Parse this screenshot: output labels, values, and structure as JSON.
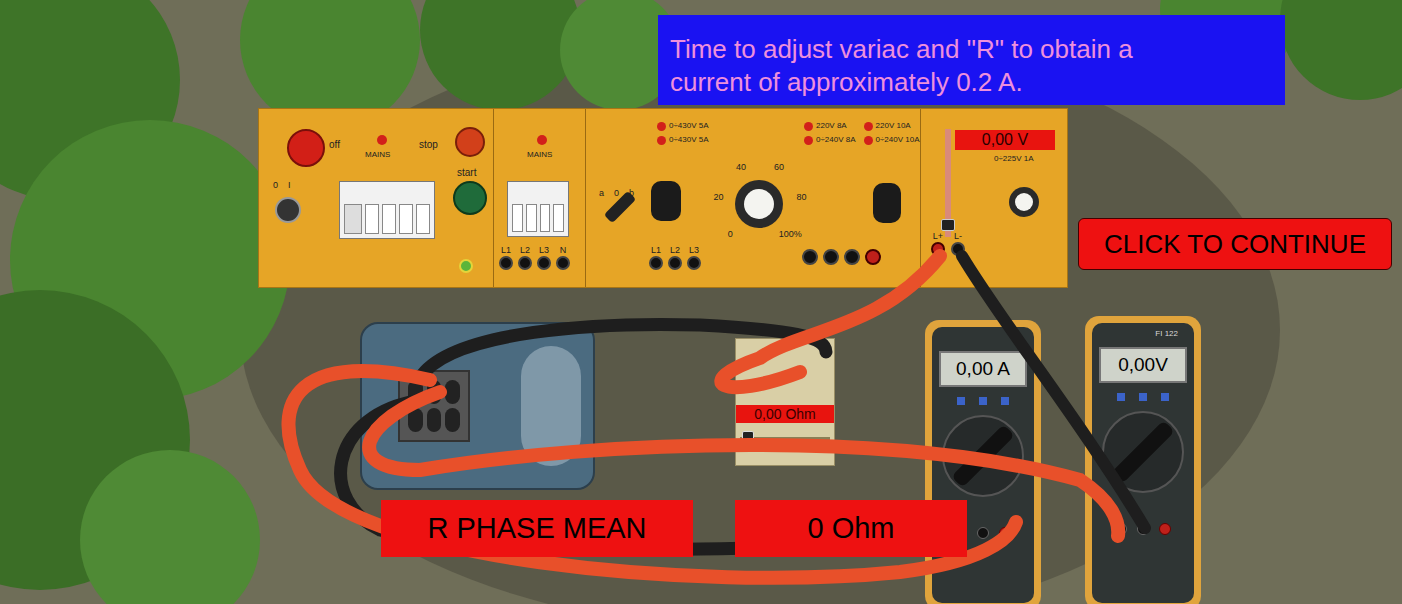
{
  "instruction": [
    "Time to adjust variac and \"R\" to obtain a",
    "current of approximately 0.2 A."
  ],
  "continue_button": "CLICK TO CONTINUE",
  "panel": {
    "off_label": "off",
    "stop_label": "stop",
    "start_label": "start",
    "mains_labels": [
      "MAINS",
      "MAINS"
    ],
    "switch_labels": [
      "0",
      "I"
    ],
    "sockets_1": [
      "L1",
      "L2",
      "L3",
      "N"
    ],
    "sockets_2": [
      "L1",
      "L2",
      "L3"
    ],
    "selector_labels": [
      "a",
      "0",
      "b"
    ],
    "lamps_left": [
      "0÷430V 5A",
      "0÷430V 5A"
    ],
    "lamps_right": [
      "220V 8A",
      "0÷240V 8A",
      "220V 10A",
      "0÷240V 10A"
    ],
    "dial_ticks": [
      "0",
      "20",
      "40",
      "60",
      "80",
      "100%"
    ],
    "dc_terminals": [
      "L+",
      "L-"
    ],
    "dc_rating": "0÷225V 1A",
    "dc_reading": "0,00 V",
    "dc_level": 0
  },
  "resistor": {
    "reading": "0,00 Ohm",
    "level": 0
  },
  "ammeter": {
    "reading": "0,00 A",
    "model": ""
  },
  "voltmeter": {
    "reading": "0,00V",
    "model": "FI 122"
  },
  "result": {
    "label": "R PHASE MEAN",
    "value": "0 Ohm"
  }
}
